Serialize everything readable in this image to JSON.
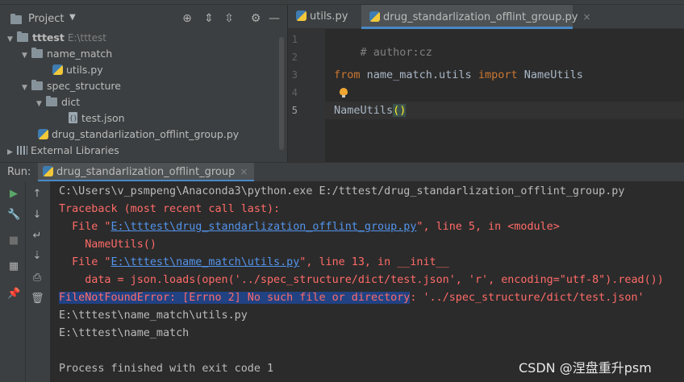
{
  "project": {
    "title": "Project",
    "tree": {
      "root": {
        "name": "tttest",
        "path": "E:\\tttest"
      },
      "name_match": "name_match",
      "utils": "utils.py",
      "spec_structure": "spec_structure",
      "dict": "dict",
      "test_json": "test.json",
      "drug_file": "drug_standarlization_offlint_group.py",
      "external_libraries": "External Libraries"
    }
  },
  "editor": {
    "tabs": [
      {
        "label": "utils.py"
      },
      {
        "label": "drug_standarlization_offlint_group.py"
      }
    ],
    "line_numbers": [
      "1",
      "2",
      "3",
      "4",
      "5"
    ],
    "code": {
      "line1": "# author:cz",
      "line3_kw1": "from",
      "line3_mod": " name_match.utils ",
      "line3_kw2": "import",
      "line3_name": " NameUtils",
      "line5_name": "NameUtils",
      "line5_parens": "()"
    }
  },
  "run": {
    "label": "Run:",
    "tab_label": "drug_standarlization_offlint_group"
  },
  "console": {
    "cmd": "C:\\Users\\v_psmpeng\\Anaconda3\\python.exe E:/tttest/drug_standarlization_offlint_group.py",
    "traceback_head": "Traceback (most recent call last):",
    "frame1_pre": "  File \"",
    "frame1_link": "E:\\tttest\\drug_standarlization_offlint_group.py",
    "frame1_post": "\", line 5, in <module>",
    "frame1_code": "    NameUtils()",
    "frame2_pre": "  File \"",
    "frame2_link": "E:\\tttest\\name_match\\utils.py",
    "frame2_post": "\", line 13, in __init__",
    "frame2_code": "    data = json.loads(open('../spec_structure/dict/test.json', 'r', encoding=\"utf-8\").read())",
    "error_selected": "FileNotFoundError: [Errno 2] No such file or directory",
    "error_rest": ": '../spec_structure/dict/test.json'",
    "out1": "E:\\tttest\\name_match\\utils.py",
    "out2": "E:\\tttest\\name_match",
    "finished": "Process finished with exit code 1"
  },
  "watermark": "CSDN @涅盘重升psm",
  "colors": {
    "accent": "#4a88c7",
    "error": "#ff6b68",
    "link": "#5394ec",
    "keyword": "#cc7832",
    "comment": "#808080",
    "selection": "#214283"
  }
}
